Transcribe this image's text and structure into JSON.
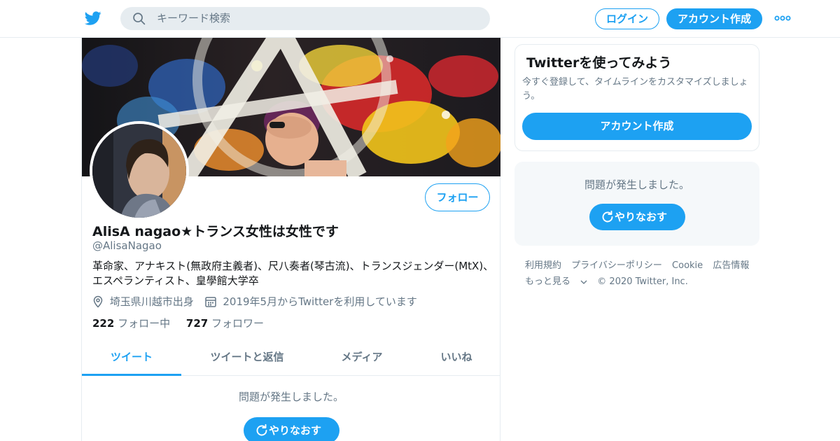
{
  "header": {
    "search_placeholder": "キーワード検索",
    "login_label": "ログイン",
    "signup_label": "アカウント作成",
    "more_icon": "more-dots-icon"
  },
  "profile": {
    "display_name": "AlisA nagao★トランス女性は女性です",
    "handle": "@AlisaNagao",
    "follow_label": "フォロー",
    "bio": "革命家、アナキスト(無政府主義者)、尺八奏者(琴古流)、トランスジェンダー(MtX)、エスペランティスト、皇學館大学卒",
    "location": "埼玉県川越市出身",
    "joined": "2019年5月からTwitterを利用しています",
    "following_count": "222",
    "following_label": "フォロー中",
    "followers_count": "727",
    "followers_label": "フォロワー"
  },
  "tabs": [
    {
      "label": "ツイート",
      "active": true
    },
    {
      "label": "ツイートと返信",
      "active": false
    },
    {
      "label": "メディア",
      "active": false
    },
    {
      "label": "いいね",
      "active": false
    }
  ],
  "timeline": {
    "error_text": "問題が発生しました。",
    "retry_label": "やりなおす"
  },
  "sidebar": {
    "signup_card": {
      "title": "Twitterを使ってみよう",
      "subtitle": "今すぐ登録して、タイムラインをカスタマイズしましょう。",
      "button_label": "アカウント作成"
    },
    "error_card": {
      "error_text": "問題が発生しました。",
      "retry_label": "やりなおす"
    },
    "footer": {
      "links": [
        "利用規約",
        "プライバシーポリシー",
        "Cookie",
        "広告情報"
      ],
      "more_label": "もっと見る",
      "copyright": "© 2020 Twitter, Inc."
    }
  },
  "colors": {
    "accent": "#1da1f2",
    "text_primary": "#14171a",
    "text_secondary": "#657786",
    "border": "#e6ecf0"
  }
}
